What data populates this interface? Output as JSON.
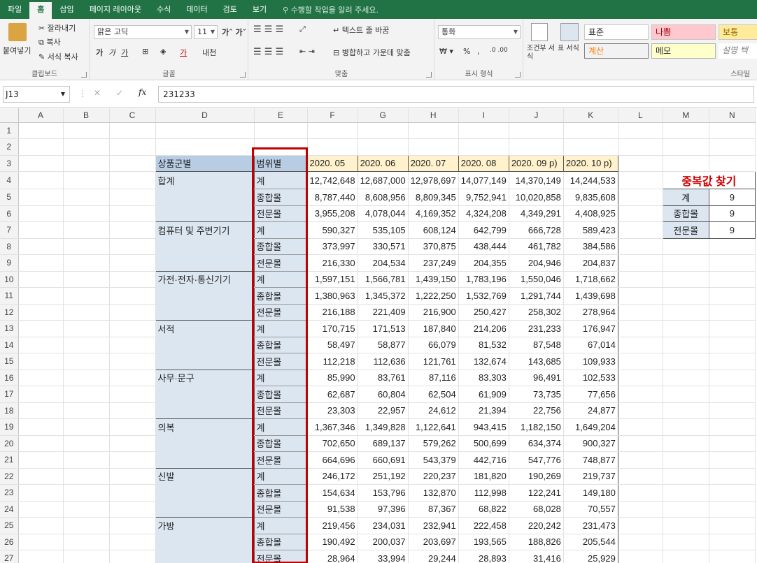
{
  "menu": {
    "tabs": [
      "파일",
      "홈",
      "삽입",
      "페이지 레이아웃",
      "수식",
      "데이터",
      "검토",
      "보기"
    ],
    "tell_me": "수행할 작업을 알려 주세요."
  },
  "ribbon": {
    "clipboard": {
      "paste": "붙여넣기",
      "cut": "잘라내기",
      "copy": "복사",
      "format_painter": "서식 복사",
      "label": "클립보드"
    },
    "font": {
      "name": "맑은 고딕",
      "size": "11",
      "label": "글꼴"
    },
    "alignment": {
      "wrap": "텍스트 줄 바꿈",
      "merge": "병합하고 가운데 맞춤",
      "label": "맞춤"
    },
    "number": {
      "format": "통화",
      "label": "표시 형식"
    },
    "styles": {
      "conditional": "조건부 서식",
      "table": "표 서식",
      "normal": "표준",
      "bad": "나쁨",
      "neutral": "보통",
      "calc": "계산",
      "memo": "메모",
      "explain": "설명 텍",
      "label": "스타일"
    }
  },
  "formula_bar": {
    "cell_ref": "J13",
    "value": "231233"
  },
  "columns": [
    "A",
    "B",
    "C",
    "D",
    "E",
    "F",
    "G",
    "H",
    "I",
    "J",
    "K",
    "L",
    "M",
    "N"
  ],
  "header": {
    "category": "상품군별",
    "scope": "범위별",
    "periods": [
      "2020. 05",
      "2020. 06",
      "2020. 07",
      "2020. 08",
      "2020. 09 p)",
      "2020. 10 p)"
    ]
  },
  "groups": [
    {
      "name": "합계",
      "rows": [
        {
          "type": "계",
          "values": [
            "12,742,648",
            "12,687,000",
            "12,978,697",
            "14,077,149",
            "14,370,149",
            "14,244,533"
          ]
        },
        {
          "type": "종합몰",
          "values": [
            "8,787,440",
            "8,608,956",
            "8,809,345",
            "9,752,941",
            "10,020,858",
            "9,835,608"
          ]
        },
        {
          "type": "전문몰",
          "values": [
            "3,955,208",
            "4,078,044",
            "4,169,352",
            "4,324,208",
            "4,349,291",
            "4,408,925"
          ]
        }
      ]
    },
    {
      "name": "컴퓨터 및 주변기기",
      "rows": [
        {
          "type": "계",
          "values": [
            "590,327",
            "535,105",
            "608,124",
            "642,799",
            "666,728",
            "589,423"
          ]
        },
        {
          "type": "종합몰",
          "values": [
            "373,997",
            "330,571",
            "370,875",
            "438,444",
            "461,782",
            "384,586"
          ]
        },
        {
          "type": "전문몰",
          "values": [
            "216,330",
            "204,534",
            "237,249",
            "204,355",
            "204,946",
            "204,837"
          ]
        }
      ]
    },
    {
      "name": "가전·전자·통신기기",
      "rows": [
        {
          "type": "계",
          "values": [
            "1,597,151",
            "1,566,781",
            "1,439,150",
            "1,783,196",
            "1,550,046",
            "1,718,662"
          ]
        },
        {
          "type": "종합몰",
          "values": [
            "1,380,963",
            "1,345,372",
            "1,222,250",
            "1,532,769",
            "1,291,744",
            "1,439,698"
          ]
        },
        {
          "type": "전문몰",
          "values": [
            "216,188",
            "221,409",
            "216,900",
            "250,427",
            "258,302",
            "278,964"
          ]
        }
      ]
    },
    {
      "name": "서적",
      "rows": [
        {
          "type": "계",
          "values": [
            "170,715",
            "171,513",
            "187,840",
            "214,206",
            "231,233",
            "176,947"
          ]
        },
        {
          "type": "종합몰",
          "values": [
            "58,497",
            "58,877",
            "66,079",
            "81,532",
            "87,548",
            "67,014"
          ]
        },
        {
          "type": "전문몰",
          "values": [
            "112,218",
            "112,636",
            "121,761",
            "132,674",
            "143,685",
            "109,933"
          ]
        }
      ]
    },
    {
      "name": "사무·문구",
      "rows": [
        {
          "type": "계",
          "values": [
            "85,990",
            "83,761",
            "87,116",
            "83,303",
            "96,491",
            "102,533"
          ]
        },
        {
          "type": "종합몰",
          "values": [
            "62,687",
            "60,804",
            "62,504",
            "61,909",
            "73,735",
            "77,656"
          ]
        },
        {
          "type": "전문몰",
          "values": [
            "23,303",
            "22,957",
            "24,612",
            "21,394",
            "22,756",
            "24,877"
          ]
        }
      ]
    },
    {
      "name": "의복",
      "rows": [
        {
          "type": "계",
          "values": [
            "1,367,346",
            "1,349,828",
            "1,122,641",
            "943,415",
            "1,182,150",
            "1,649,204"
          ]
        },
        {
          "type": "종합몰",
          "values": [
            "702,650",
            "689,137",
            "579,262",
            "500,699",
            "634,374",
            "900,327"
          ]
        },
        {
          "type": "전문몰",
          "values": [
            "664,696",
            "660,691",
            "543,379",
            "442,716",
            "547,776",
            "748,877"
          ]
        }
      ]
    },
    {
      "name": "신발",
      "rows": [
        {
          "type": "계",
          "values": [
            "246,172",
            "251,192",
            "220,237",
            "181,820",
            "190,269",
            "219,737"
          ]
        },
        {
          "type": "종합몰",
          "values": [
            "154,634",
            "153,796",
            "132,870",
            "112,998",
            "122,241",
            "149,180"
          ]
        },
        {
          "type": "전문몰",
          "values": [
            "91,538",
            "97,396",
            "87,367",
            "68,822",
            "68,028",
            "70,557"
          ]
        }
      ]
    },
    {
      "name": "가방",
      "rows": [
        {
          "type": "계",
          "values": [
            "219,456",
            "234,031",
            "232,941",
            "222,458",
            "220,242",
            "231,473"
          ]
        },
        {
          "type": "종합몰",
          "values": [
            "190,492",
            "200,037",
            "203,697",
            "193,565",
            "188,826",
            "205,544"
          ]
        },
        {
          "type": "전문몰",
          "values": [
            "28,964",
            "33,994",
            "29,244",
            "28,893",
            "31,416",
            "25,929"
          ]
        }
      ]
    }
  ],
  "dup_finder": {
    "title": "중복값 찾기",
    "rows": [
      {
        "label": "계",
        "count": "9"
      },
      {
        "label": "종합몰",
        "count": "9"
      },
      {
        "label": "전문몰",
        "count": "9"
      }
    ]
  }
}
